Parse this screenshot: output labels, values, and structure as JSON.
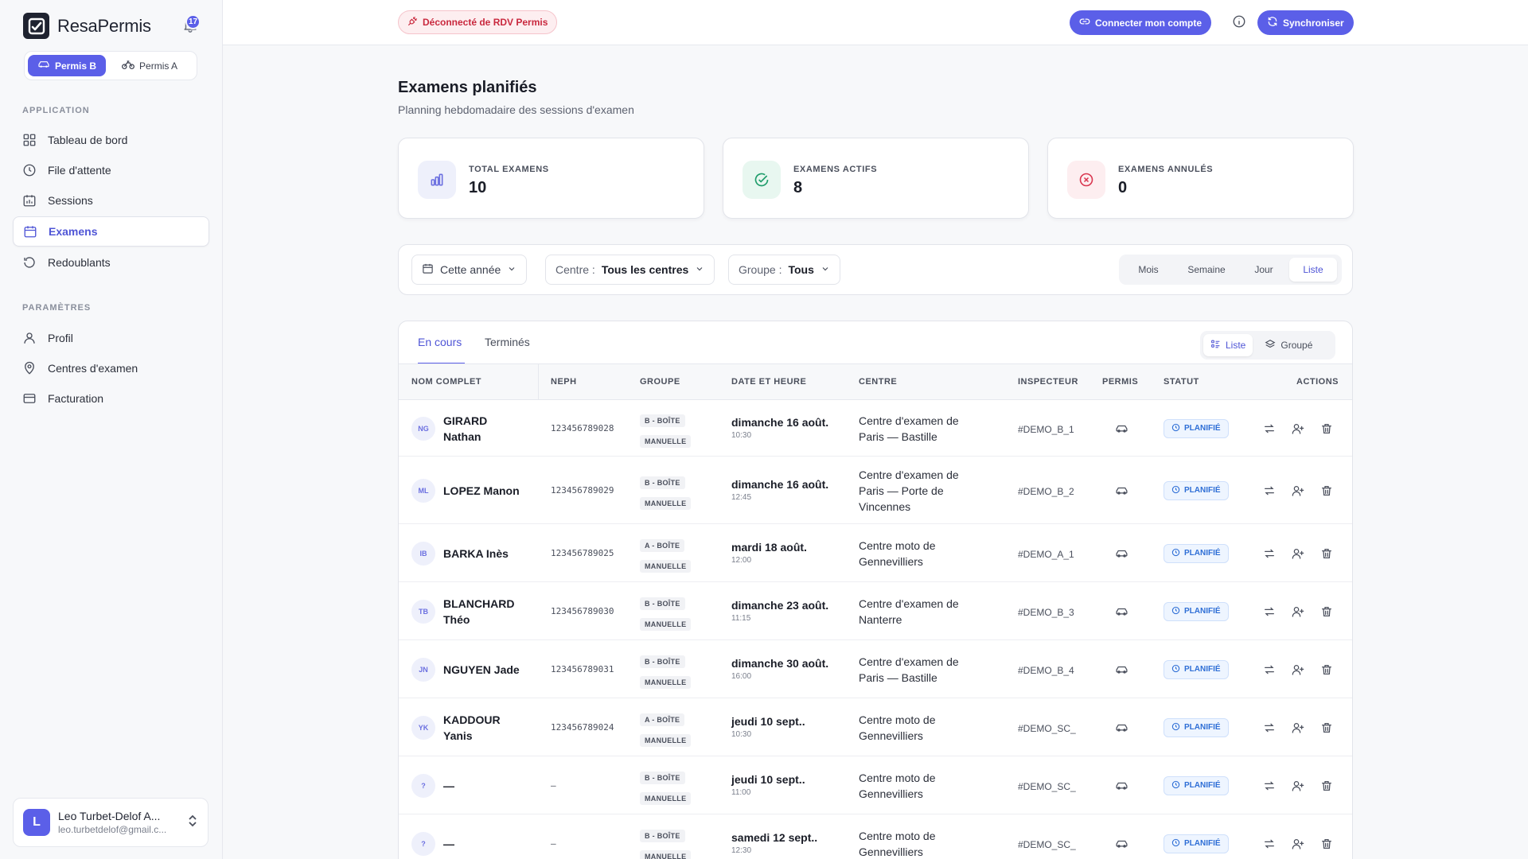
{
  "app": {
    "name": "ResaPermis",
    "notifications": "17"
  },
  "permis_switch": {
    "b": "Permis B",
    "a": "Permis A"
  },
  "sidebar": {
    "section_app": "APPLICATION",
    "items_app": [
      {
        "label": "Tableau de bord",
        "icon": "dashboard-icon"
      },
      {
        "label": "File d'attente",
        "icon": "clock-icon"
      },
      {
        "label": "Sessions",
        "icon": "calendar-chart-icon"
      },
      {
        "label": "Examens",
        "icon": "calendar-icon",
        "active": true
      },
      {
        "label": "Redoublants",
        "icon": "history-icon"
      }
    ],
    "section_params": "PARAMÈTRES",
    "items_params": [
      {
        "label": "Profil",
        "icon": "user-icon"
      },
      {
        "label": "Centres d'examen",
        "icon": "map-pin-icon"
      },
      {
        "label": "Facturation",
        "icon": "credit-card-icon"
      }
    ]
  },
  "user": {
    "initial": "L",
    "name": "Leo Turbet-Delof A...",
    "email": "leo.turbetdelof@gmail.c..."
  },
  "topbar": {
    "disconnected": "Déconnecté de RDV Permis",
    "connect": "Connecter mon compte",
    "sync": "Synchroniser"
  },
  "page": {
    "title": "Examens planifiés",
    "subtitle": "Planning hebdomadaire des sessions d'examen"
  },
  "stats": [
    {
      "label": "TOTAL EXAMENS",
      "value": "10",
      "icon": "bar-chart-icon",
      "color": "#6b6fe0",
      "bg": "#eef0fb"
    },
    {
      "label": "EXAMENS ACTIFS",
      "value": "8",
      "icon": "check-circle-icon",
      "color": "#1f9d6b",
      "bg": "#e8f7f0"
    },
    {
      "label": "EXAMENS ANNULÉS",
      "value": "0",
      "icon": "x-circle-icon",
      "color": "#d9364f",
      "bg": "#fdeef0"
    }
  ],
  "filters": {
    "period": "Cette année",
    "centre_label": "Centre :",
    "centre_value": "Tous les centres",
    "group_label": "Groupe :",
    "group_value": "Tous",
    "views": [
      "Mois",
      "Semaine",
      "Jour",
      "Liste"
    ]
  },
  "tabs": {
    "current": "En cours",
    "done": "Terminés"
  },
  "modes": {
    "list": "Liste",
    "grouped": "Groupé"
  },
  "columns": {
    "name": "NOM COMPLET",
    "neph": "NEPH",
    "group": "GROUPE",
    "date": "DATE ET HEURE",
    "centre": "CENTRE",
    "inspector": "INSPECTEUR",
    "permis": "PERMIS",
    "status": "STATUT",
    "actions": "ACTIONS"
  },
  "rows": [
    {
      "initials": "NG",
      "name1": "GIRARD",
      "name2": "Nathan",
      "neph": "123456789028",
      "group1": "B - BOÎTE",
      "group2": "MANUELLE",
      "date": "dimanche 16 août.",
      "time": "10:30",
      "centre1": "Centre d'examen de",
      "centre2": "Paris — Bastille",
      "centre3": "",
      "inspector": "#DEMO_B_1",
      "status": "PLANIFIÉ"
    },
    {
      "initials": "ML",
      "name1": "LOPEZ Manon",
      "name2": "",
      "neph": "123456789029",
      "group1": "B - BOÎTE",
      "group2": "MANUELLE",
      "date": "dimanche 16 août.",
      "time": "12:45",
      "centre1": "Centre d'examen de",
      "centre2": "Paris — Porte de",
      "centre3": "Vincennes",
      "inspector": "#DEMO_B_2",
      "status": "PLANIFIÉ"
    },
    {
      "initials": "IB",
      "name1": "BARKA Inès",
      "name2": "",
      "neph": "123456789025",
      "group1": "A - BOÎTE",
      "group2": "MANUELLE",
      "date": "mardi 18 août.",
      "time": "12:00",
      "centre1": "Centre moto de",
      "centre2": "Gennevilliers",
      "centre3": "",
      "inspector": "#DEMO_A_1",
      "status": "PLANIFIÉ"
    },
    {
      "initials": "TB",
      "name1": "BLANCHARD",
      "name2": "Théo",
      "neph": "123456789030",
      "group1": "B - BOÎTE",
      "group2": "MANUELLE",
      "date": "dimanche 23 août.",
      "time": "11:15",
      "centre1": "Centre d'examen de",
      "centre2": "Nanterre",
      "centre3": "",
      "inspector": "#DEMO_B_3",
      "status": "PLANIFIÉ"
    },
    {
      "initials": "JN",
      "name1": "NGUYEN Jade",
      "name2": "",
      "neph": "123456789031",
      "group1": "B - BOÎTE",
      "group2": "MANUELLE",
      "date": "dimanche 30 août.",
      "time": "16:00",
      "centre1": "Centre d'examen de",
      "centre2": "Paris — Bastille",
      "centre3": "",
      "inspector": "#DEMO_B_4",
      "status": "PLANIFIÉ"
    },
    {
      "initials": "YK",
      "name1": "KADDOUR",
      "name2": "Yanis",
      "neph": "123456789024",
      "group1": "A - BOÎTE",
      "group2": "MANUELLE",
      "date": "jeudi 10 sept..",
      "time": "10:30",
      "centre1": "Centre moto de",
      "centre2": "Gennevilliers",
      "centre3": "",
      "inspector": "#DEMO_SC_",
      "status": "PLANIFIÉ"
    },
    {
      "initials": "?",
      "name1": "—",
      "name2": "",
      "neph": "–",
      "group1": "B - BOÎTE",
      "group2": "MANUELLE",
      "date": "jeudi 10 sept..",
      "time": "11:00",
      "centre1": "Centre moto de",
      "centre2": "Gennevilliers",
      "centre3": "",
      "inspector": "#DEMO_SC_",
      "status": "PLANIFIÉ"
    },
    {
      "initials": "?",
      "name1": "—",
      "name2": "",
      "neph": "–",
      "group1": "B - BOÎTE",
      "group2": "MANUELLE",
      "date": "samedi 12 sept..",
      "time": "12:30",
      "centre1": "Centre moto de",
      "centre2": "Gennevilliers",
      "centre3": "",
      "inspector": "#DEMO_SC_",
      "status": "PLANIFIÉ"
    }
  ]
}
